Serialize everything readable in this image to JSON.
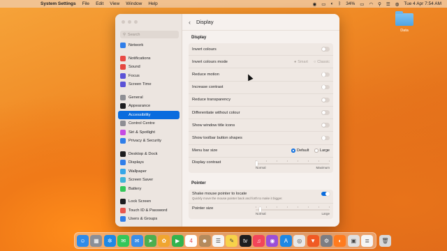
{
  "menubar": {
    "app_name": "System Settings",
    "menus": [
      "File",
      "Edit",
      "View",
      "Window",
      "Help"
    ],
    "battery": "34%",
    "datetime": "Tue 4 Apr  7:54 AM"
  },
  "desktop": {
    "folder_label": "Data"
  },
  "sidebar": {
    "search_placeholder": "Search",
    "items": [
      {
        "label": "Network",
        "icon": "globe-icon",
        "color": "#2f7ee9"
      },
      {
        "label": "Notifications",
        "icon": "bell-icon",
        "color": "#e84a45"
      },
      {
        "label": "Sound",
        "icon": "speaker-icon",
        "color": "#e5463f"
      },
      {
        "label": "Focus",
        "icon": "moon-icon",
        "color": "#5b52d6"
      },
      {
        "label": "Screen Time",
        "icon": "hourglass-icon",
        "color": "#5b52d6"
      },
      {
        "label": "General",
        "icon": "gear-icon",
        "color": "#8e8e93"
      },
      {
        "label": "Appearance",
        "icon": "appearance-icon",
        "color": "#1d1d1f"
      },
      {
        "label": "Accessibility",
        "icon": "accessibility-icon",
        "color": "#0a6cde",
        "active": true
      },
      {
        "label": "Control Centre",
        "icon": "control-centre-icon",
        "color": "#8e8e93"
      },
      {
        "label": "Siri & Spotlight",
        "icon": "siri-icon",
        "color": "#c54be3"
      },
      {
        "label": "Privacy & Security",
        "icon": "hand-icon",
        "color": "#2f7ee9"
      },
      {
        "label": "Desktop & Dock",
        "icon": "dock-icon",
        "color": "#1d1d1f"
      },
      {
        "label": "Displays",
        "icon": "display-icon",
        "color": "#2f7ee9"
      },
      {
        "label": "Wallpaper",
        "icon": "wallpaper-icon",
        "color": "#35a6e8"
      },
      {
        "label": "Screen Saver",
        "icon": "screensaver-icon",
        "color": "#3fb4d8"
      },
      {
        "label": "Battery",
        "icon": "battery-icon",
        "color": "#34c759"
      },
      {
        "label": "Lock Screen",
        "icon": "lock-icon",
        "color": "#1d1d1f"
      },
      {
        "label": "Touch ID & Password",
        "icon": "fingerprint-icon",
        "color": "#e8574f"
      },
      {
        "label": "Users & Groups",
        "icon": "users-icon",
        "color": "#2f7ee9"
      }
    ]
  },
  "main": {
    "title": "Display",
    "display_section": "Display",
    "rows": {
      "invert_colours": "Invert colours",
      "invert_colours_mode": "Invert colours mode",
      "mode_smart": "Smart",
      "mode_classic": "Classic",
      "reduce_motion": "Reduce motion",
      "increase_contrast": "Increase contrast",
      "reduce_transparency": "Reduce transparency",
      "differentiate": "Differentiate without colour",
      "window_title_icons": "Show window title icons",
      "toolbar_button_shapes": "Show toolbar button shapes",
      "menu_bar_size": "Menu bar size",
      "size_default": "Default",
      "size_large": "Large",
      "display_contrast": "Display contrast",
      "contrast_min": "Normal",
      "contrast_max": "Maximum"
    },
    "pointer_section": "Pointer",
    "pointer": {
      "shake_label": "Shake mouse pointer to locate",
      "shake_sub": "Quickly move the mouse pointer back and forth to make it bigger.",
      "pointer_size": "Pointer size",
      "size_min": "Normal",
      "size_max": "Large"
    },
    "state": {
      "display_contrast_level": 0,
      "pointer_size_level": 0.05,
      "shake_enabled": true,
      "menu_bar_size_selected": "Default"
    }
  },
  "dock": {
    "apps": [
      {
        "name": "finder-icon",
        "color": "#2f8be8",
        "glyph": "☺"
      },
      {
        "name": "launchpad-icon",
        "color": "#8a8f98",
        "glyph": "▦"
      },
      {
        "name": "safari-icon",
        "color": "#1e88e5",
        "glyph": "✲"
      },
      {
        "name": "messages-icon",
        "color": "#34c759",
        "glyph": "✉"
      },
      {
        "name": "mail-icon",
        "color": "#3b8ee8",
        "glyph": "✉"
      },
      {
        "name": "maps-icon",
        "color": "#4cae4f",
        "glyph": "➤"
      },
      {
        "name": "photos-icon",
        "color": "#f0a530",
        "glyph": "✿"
      },
      {
        "name": "facetime-icon",
        "color": "#33b34e",
        "glyph": "▶"
      },
      {
        "name": "calendar-icon",
        "color": "#ffffff",
        "glyph": "4"
      },
      {
        "name": "contacts-icon",
        "color": "#b48a5c",
        "glyph": "☻"
      },
      {
        "name": "reminders-icon",
        "color": "#f5f5f5",
        "glyph": "☰"
      },
      {
        "name": "notes-icon",
        "color": "#f7d24a",
        "glyph": "✎"
      },
      {
        "name": "tv-icon",
        "color": "#1d1d1f",
        "glyph": "tv"
      },
      {
        "name": "music-icon",
        "color": "#f2455a",
        "glyph": "♫"
      },
      {
        "name": "podcasts-icon",
        "color": "#9b4fd8",
        "glyph": "◉"
      },
      {
        "name": "app-store-icon",
        "color": "#1e88e5",
        "glyph": "A"
      },
      {
        "name": "chrome-icon",
        "color": "#e8e8e8",
        "glyph": "◎"
      },
      {
        "name": "brave-icon",
        "color": "#f05a23",
        "glyph": "▼"
      },
      {
        "name": "system-settings-icon",
        "color": "#7d7d82",
        "glyph": "⚙"
      },
      {
        "name": "firefox-icon",
        "color": "#ff7b1e",
        "glyph": "◐"
      },
      {
        "name": "preview-icon",
        "color": "#e0e0e0",
        "glyph": "▣"
      },
      {
        "name": "text-edit-icon",
        "color": "#f5f5f5",
        "glyph": "≣"
      },
      {
        "name": "trash-icon",
        "color": "#d8d8da",
        "glyph": "🗑"
      }
    ]
  }
}
